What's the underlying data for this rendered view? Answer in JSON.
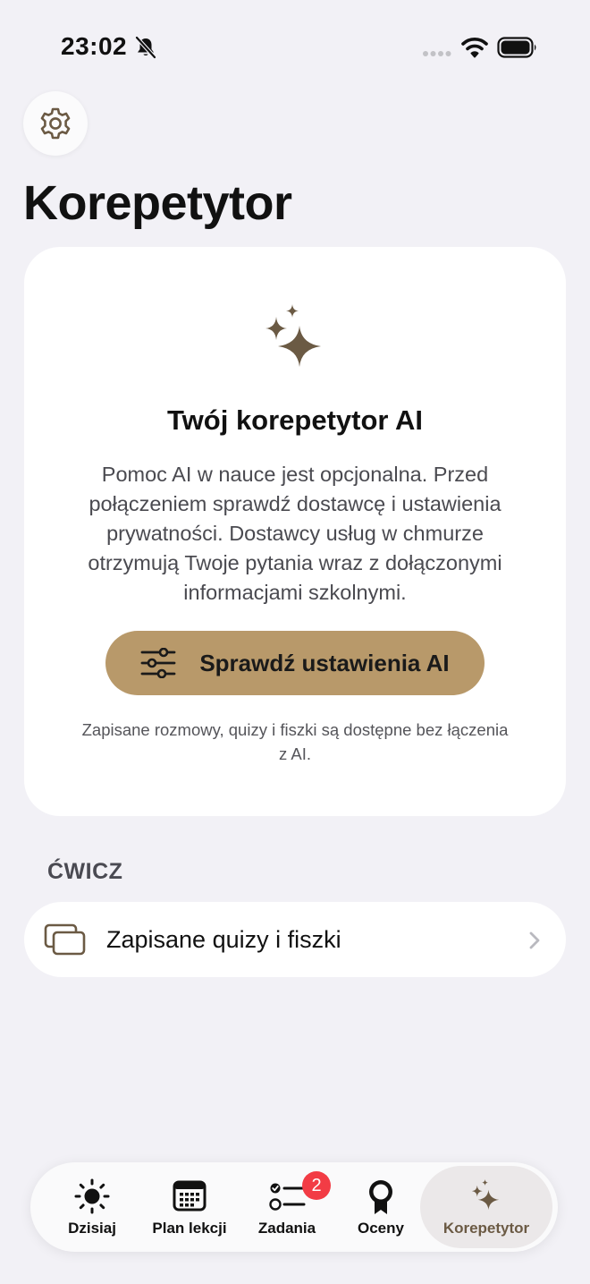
{
  "status_bar": {
    "time": "23:02",
    "icons": [
      "bell-slash-icon",
      "signal-icon",
      "wifi-icon",
      "battery-icon"
    ]
  },
  "header": {
    "settings_icon": "gear-icon",
    "title": "Korepetytor"
  },
  "tutor_card": {
    "icon": "sparkles-icon",
    "title": "Twój korepetytor AI",
    "description": "Pomoc AI w nauce jest opcjonalna. Przed połączeniem sprawdź dostawcę i ustawienia prywatności. Dostawcy usług w chmurze otrzymują Twoje pytania wraz z dołączonymi informacjami szkolnymi.",
    "button_label": "Sprawdź ustawienia AI",
    "button_icon": "sliders-icon",
    "note": "Zapisane rozmowy, quizy i fiszki są dostępne bez łączenia z AI."
  },
  "practice_section": {
    "header": "ĆWICZ",
    "items": [
      {
        "label": "Zapisane quizy i fiszki",
        "icon": "cards-icon"
      }
    ]
  },
  "tab_bar": {
    "tabs": [
      {
        "label": "Dzisiaj",
        "icon": "sun-icon"
      },
      {
        "label": "Plan lekcji",
        "icon": "calendar-icon"
      },
      {
        "label": "Zadania",
        "icon": "checklist-icon",
        "badge": "2"
      },
      {
        "label": "Oceny",
        "icon": "award-icon"
      },
      {
        "label": "Korepetytor",
        "icon": "sparkles-icon",
        "active": true
      }
    ]
  },
  "colors": {
    "accent": "#b8996a",
    "accent_dark": "#6b5a44",
    "badge": "#f23c45",
    "background": "#f2f1f6"
  }
}
